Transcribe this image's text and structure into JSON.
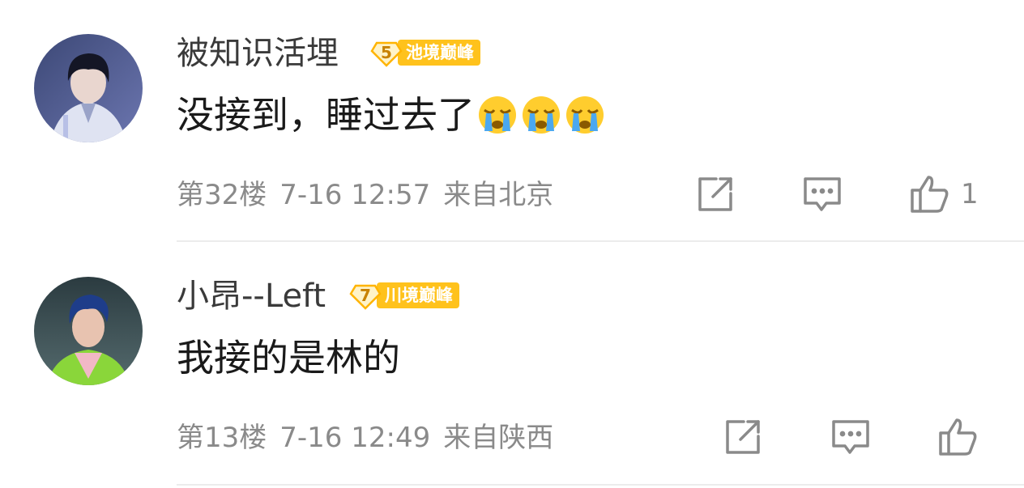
{
  "comments": [
    {
      "username": "被知识活埋",
      "level": "5",
      "tier_label": "池境巅峰",
      "text": "没接到，睡过去了",
      "emoji": [
        "crying-emoji",
        "crying-emoji",
        "crying-emoji"
      ],
      "floor": "第32楼",
      "time": "7-16 12:57",
      "location": "来自北京",
      "like_count": "1"
    },
    {
      "username": "小昂--Left",
      "level": "7",
      "tier_label": "川境巅峰",
      "text": "我接的是林的",
      "emoji": [],
      "floor": "第13楼",
      "time": "7-16 12:49",
      "location": "来自陕西",
      "like_count": ""
    }
  ],
  "colors": {
    "badge": "#ffc21c",
    "meta_text": "#8a8a8a",
    "divider": "#ececec"
  },
  "icons": [
    "share-icon",
    "reply-icon",
    "like-icon"
  ]
}
